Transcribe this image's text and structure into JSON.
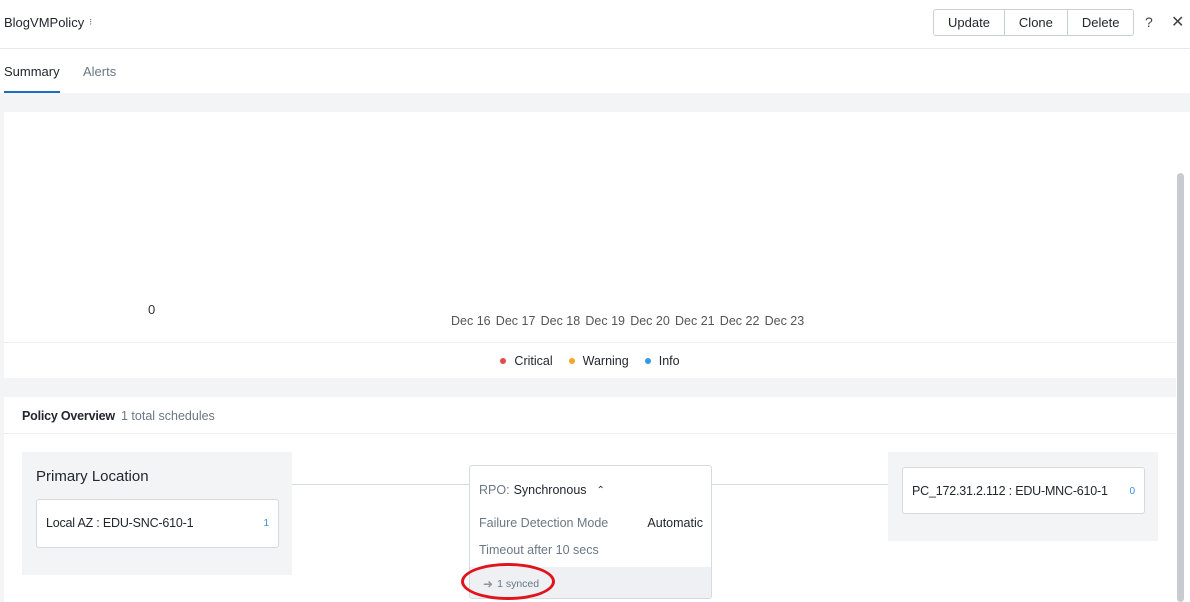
{
  "header": {
    "title": "BlogVMPolicy",
    "title_caret": "⁝",
    "buttons": [
      "Update",
      "Clone",
      "Delete"
    ],
    "help": "?",
    "close": "✕"
  },
  "tabs": [
    {
      "label": "Summary",
      "active": true
    },
    {
      "label": "Alerts",
      "active": false
    }
  ],
  "chart_data": {
    "type": "line",
    "y_tick_labels": [
      "0"
    ],
    "categories": [
      "Dec 16",
      "Dec 17",
      "Dec 18",
      "Dec 19",
      "Dec 20",
      "Dec 21",
      "Dec 22",
      "Dec 23"
    ],
    "series": [
      {
        "name": "Critical",
        "color": "#e5484d",
        "values": []
      },
      {
        "name": "Warning",
        "color": "#f5a623",
        "values": []
      },
      {
        "name": "Info",
        "color": "#2e9be6",
        "values": []
      }
    ],
    "legend_placement": "bottom-center"
  },
  "overview": {
    "title": "Policy Overview",
    "subtitle": "1 total schedules",
    "primary": {
      "label": "Primary Location",
      "site": "Local AZ : EDU-SNC-610-1",
      "count": "1"
    },
    "rpo": {
      "key": "RPO:",
      "value": "Synchronous",
      "chevron": "⌃",
      "failure_label": "Failure Detection Mode",
      "failure_value": "Automatic",
      "timeout": "Timeout after 10 secs",
      "synced": "1 synced"
    },
    "remote": {
      "site": "PC_172.31.2.112 : EDU-MNC-610-1",
      "count": "0"
    }
  },
  "colors": {
    "accent": "#1b6dc1",
    "highlight": "#e0141c"
  }
}
